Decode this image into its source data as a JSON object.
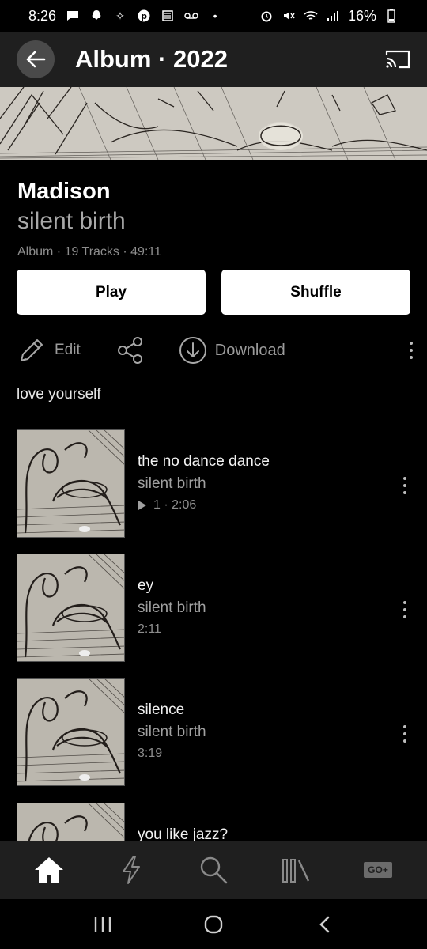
{
  "status_bar": {
    "time": "8:26",
    "battery": "16%"
  },
  "header": {
    "title": "Album · 2022",
    "back_icon": "arrow-left-icon",
    "cast_icon": "cast-icon"
  },
  "album": {
    "title": "Madison",
    "artist": "silent birth",
    "meta": "Album · 19 Tracks · 49:11",
    "description": "love yourself"
  },
  "buttons": {
    "play": "Play",
    "shuffle": "Shuffle"
  },
  "actions": {
    "edit": "Edit",
    "download": "Download"
  },
  "tracks": [
    {
      "title": "the no dance dance",
      "artist": "silent birth",
      "meta": "1 · 2:06",
      "has_play_icon": true
    },
    {
      "title": "ey",
      "artist": "silent birth",
      "meta": "2:11"
    },
    {
      "title": "silence",
      "artist": "silent birth",
      "meta": "3:19"
    },
    {
      "title": "you like jazz?",
      "artist": "",
      "meta": ""
    }
  ],
  "tabbar": {
    "go_plus": "GO+"
  },
  "colors": {
    "background": "#000000",
    "header": "#1f1f1f",
    "muted_text": "#a0a0a0",
    "button": "#ffffff"
  }
}
